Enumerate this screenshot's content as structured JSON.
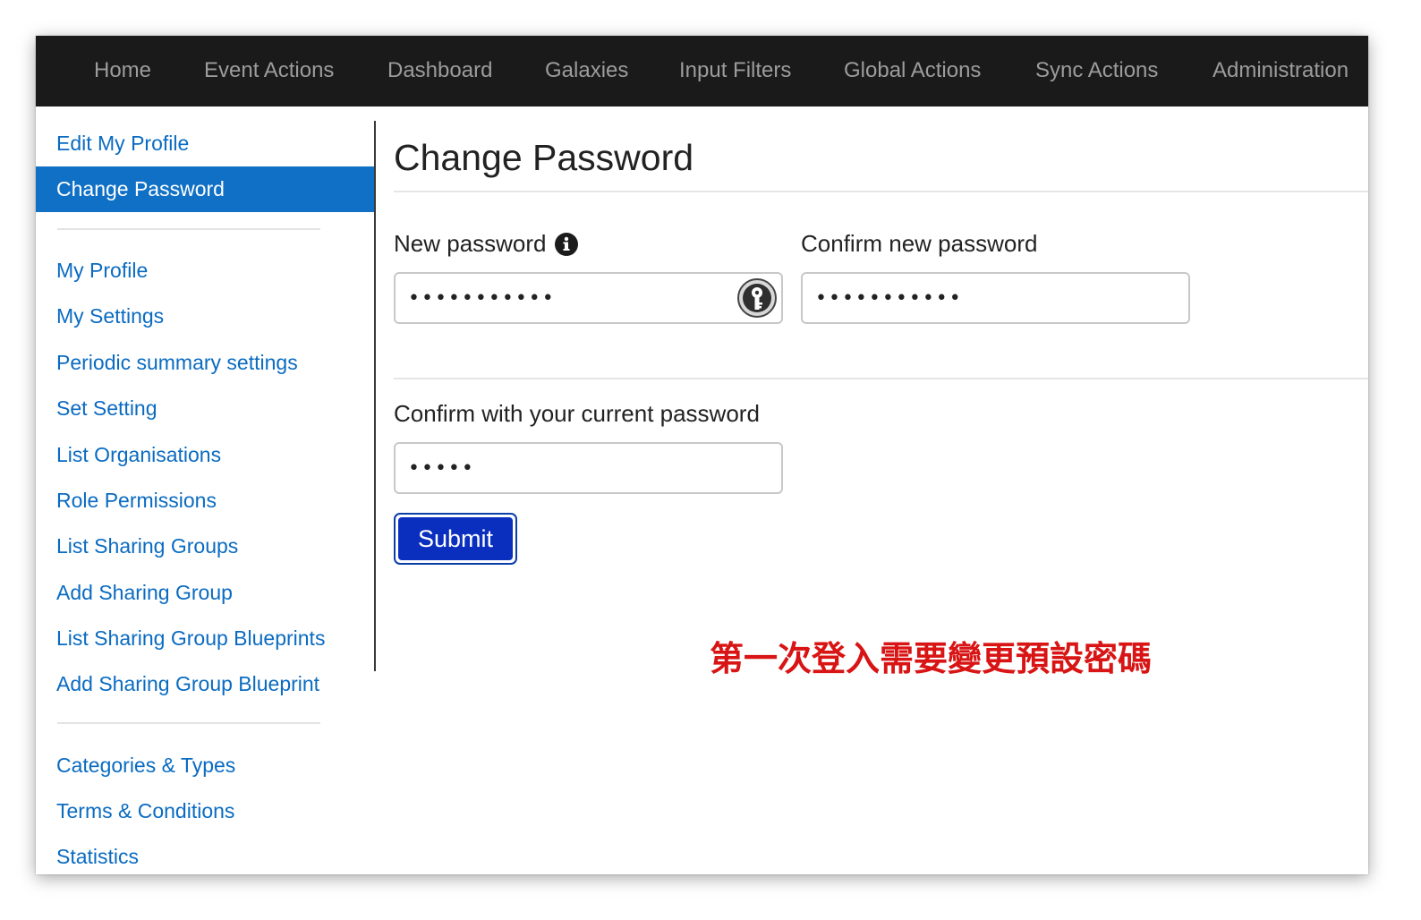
{
  "topnav": {
    "items": [
      "Home",
      "Event Actions",
      "Dashboard",
      "Galaxies",
      "Input Filters",
      "Global Actions",
      "Sync Actions",
      "Administration"
    ]
  },
  "sidebar": {
    "group1": [
      "Edit My Profile",
      "Change Password"
    ],
    "active": "Change Password",
    "group2": [
      "My Profile",
      "My Settings",
      "Periodic summary settings",
      "Set Setting",
      "List Organisations",
      "Role Permissions",
      "List Sharing Groups",
      "Add Sharing Group",
      "List Sharing Group Blueprints",
      "Add Sharing Group Blueprint"
    ],
    "group3": [
      "Categories & Types",
      "Terms & Conditions",
      "Statistics"
    ]
  },
  "main": {
    "title": "Change Password",
    "new_password": {
      "label": "New password",
      "value": "•••••••••••",
      "icon": "info-icon",
      "manager_icon": "key-icon"
    },
    "confirm_password": {
      "label": "Confirm new password",
      "value": "•••••••••••"
    },
    "current_password": {
      "label": "Confirm with your current password",
      "value": "•••••"
    },
    "submit_label": "Submit"
  },
  "annotation": {
    "text": "第一次登入需要變更預設密碼",
    "color": "#d81414"
  },
  "colors": {
    "nav_bg": "#1a1a1a",
    "link": "#0a6bc1",
    "active_bg": "#0f70c6",
    "button": "#0a2fbf"
  }
}
